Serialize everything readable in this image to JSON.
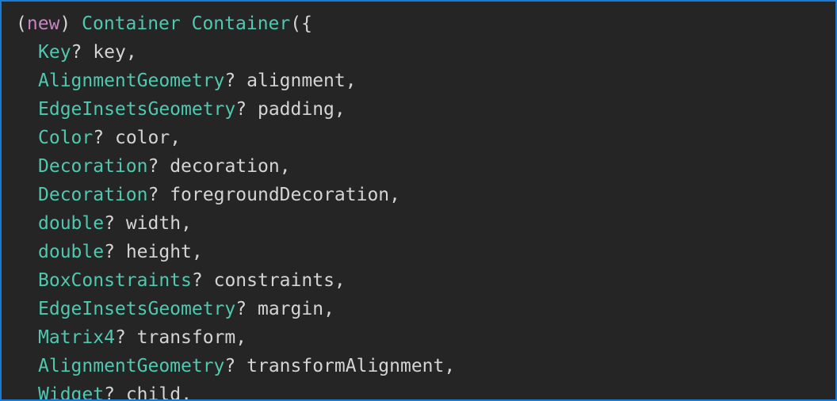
{
  "hover": {
    "signature_open": {
      "paren_open": "(",
      "keyword": "new",
      "paren_close": ")",
      "return_type": "Container",
      "constructor_name": "Container",
      "open_brace": "({"
    },
    "params": [
      {
        "type": "Key",
        "name": "key"
      },
      {
        "type": "AlignmentGeometry",
        "name": "alignment"
      },
      {
        "type": "EdgeInsetsGeometry",
        "name": "padding"
      },
      {
        "type": "Color",
        "name": "color"
      },
      {
        "type": "Decoration",
        "name": "decoration"
      },
      {
        "type": "Decoration",
        "name": "foregroundDecoration"
      },
      {
        "type": "double",
        "name": "width"
      },
      {
        "type": "double",
        "name": "height"
      },
      {
        "type": "BoxConstraints",
        "name": "constraints"
      },
      {
        "type": "EdgeInsetsGeometry",
        "name": "margin"
      },
      {
        "type": "Matrix4",
        "name": "transform"
      },
      {
        "type": "AlignmentGeometry",
        "name": "transformAlignment"
      },
      {
        "type": "Widget",
        "name": "child"
      }
    ],
    "nullable_marker": "?",
    "separator": ","
  },
  "colors": {
    "background": "#252526",
    "border": "#1a7bd4",
    "keyword": "#c586c0",
    "type": "#4ec9b0",
    "text": "#d4d4d4"
  }
}
